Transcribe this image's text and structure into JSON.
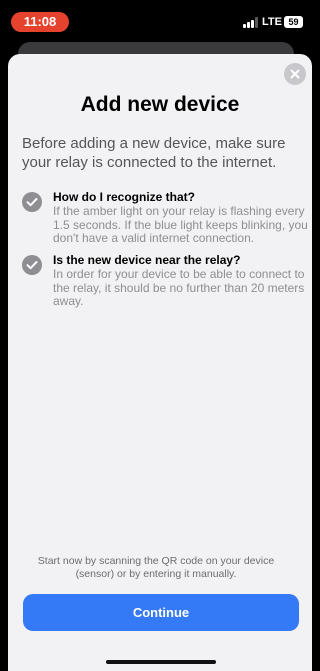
{
  "status_bar": {
    "time": "11:08",
    "network": "LTE",
    "battery": "59",
    "signal_icon": "signal-bars-icon",
    "time_pill_color": "#e5432d"
  },
  "sheet": {
    "close_icon": "close-icon",
    "title": "Add new device",
    "intro": "Before adding a new device, make sure your relay is connected to the internet.",
    "items": [
      {
        "icon": "checkmark-circle-icon",
        "heading": "How do I recognize that?",
        "body": "If the amber light on your relay is flashing every 1.5 seconds. If the blue light keeps blinking, you don't have a valid internet connection."
      },
      {
        "icon": "checkmark-circle-icon",
        "heading": "Is the new device near the relay?",
        "body": "In order for your device to be able to connect to the relay, it should be no further than 20 meters away."
      }
    ],
    "footer_note": "Start now by scanning the QR code on your device (sensor) or by entering it manually.",
    "continue_label": "Continue",
    "accent_color": "#3479f6"
  }
}
